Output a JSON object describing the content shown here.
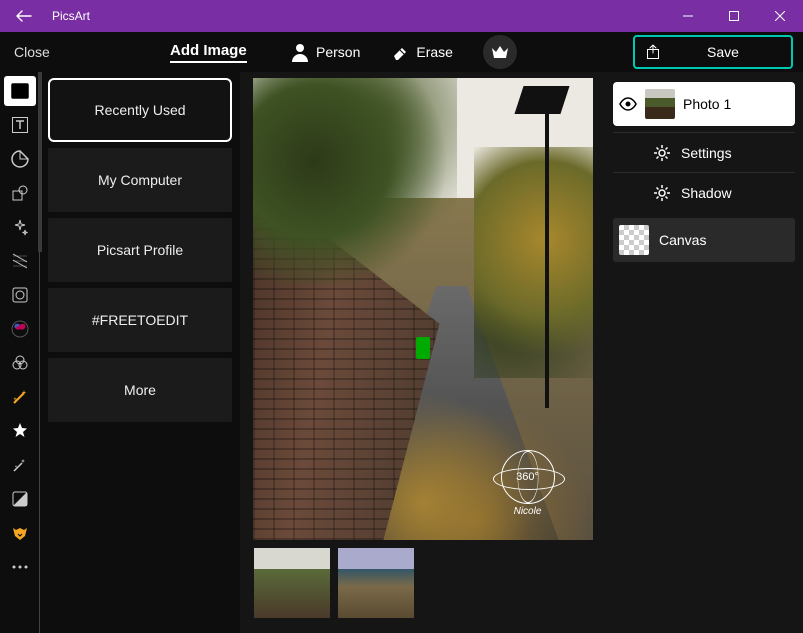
{
  "titlebar": {
    "app_name": "PicsArt"
  },
  "toolbar": {
    "close_label": "Close",
    "add_image_label": "Add Image",
    "person_label": "Person",
    "erase_label": "Erase",
    "save_label": "Save"
  },
  "sources": {
    "items": [
      {
        "label": "Recently Used"
      },
      {
        "label": "My Computer"
      },
      {
        "label": "Picsart Profile"
      },
      {
        "label": "#FREETOEDIT"
      },
      {
        "label": "More"
      }
    ]
  },
  "canvas": {
    "badge_360": "360°",
    "credit": "Nicole"
  },
  "layers": {
    "photo1_label": "Photo 1",
    "settings_label": "Settings",
    "shadow_label": "Shadow",
    "canvas_label": "Canvas"
  }
}
